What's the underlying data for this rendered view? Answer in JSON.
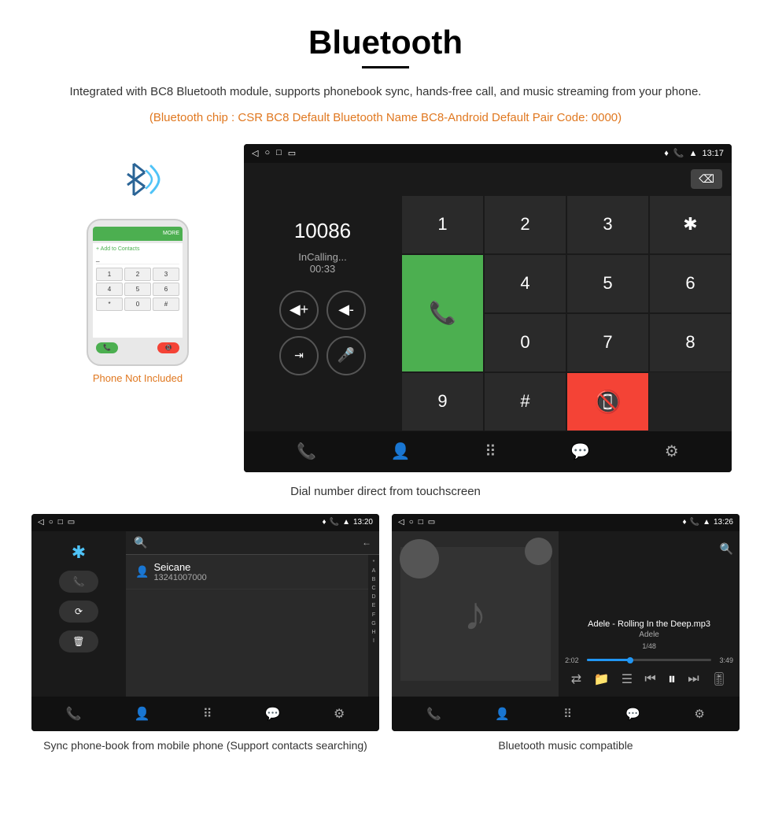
{
  "page": {
    "title": "Bluetooth",
    "description": "Integrated with BC8 Bluetooth module, supports phonebook sync, hands-free call, and music streaming from your phone.",
    "orange_info": "(Bluetooth chip : CSR BC8    Default Bluetooth Name BC8-Android    Default Pair Code: 0000)",
    "caption_dial": "Dial number direct from touchscreen",
    "caption_phonebook": "Sync phone-book from mobile phone\n(Support contacts searching)",
    "caption_music": "Bluetooth music compatible"
  },
  "dial_screen": {
    "call_number": "10086",
    "call_status": "InCalling...",
    "call_timer": "00:33",
    "status_time": "13:17",
    "keys": [
      "1",
      "2",
      "3",
      "*",
      "4",
      "5",
      "6",
      "0",
      "7",
      "8",
      "9",
      "#"
    ]
  },
  "phonebook_screen": {
    "status_time": "13:20",
    "contact_name": "Seicane",
    "contact_number": "13241007000",
    "alpha_index": [
      "*",
      "A",
      "B",
      "C",
      "D",
      "E",
      "F",
      "G",
      "H",
      "I"
    ]
  },
  "music_screen": {
    "status_time": "13:26",
    "song_title": "Adele - Rolling In the Deep.mp3",
    "artist": "Adele",
    "track_info": "1/48",
    "time_current": "2:02",
    "time_total": "3:49"
  },
  "phone_widget": {
    "not_included_label": "Phone Not Included",
    "keys": [
      "1",
      "2",
      "3",
      "4",
      "5",
      "6",
      "*",
      "0",
      "#"
    ]
  }
}
